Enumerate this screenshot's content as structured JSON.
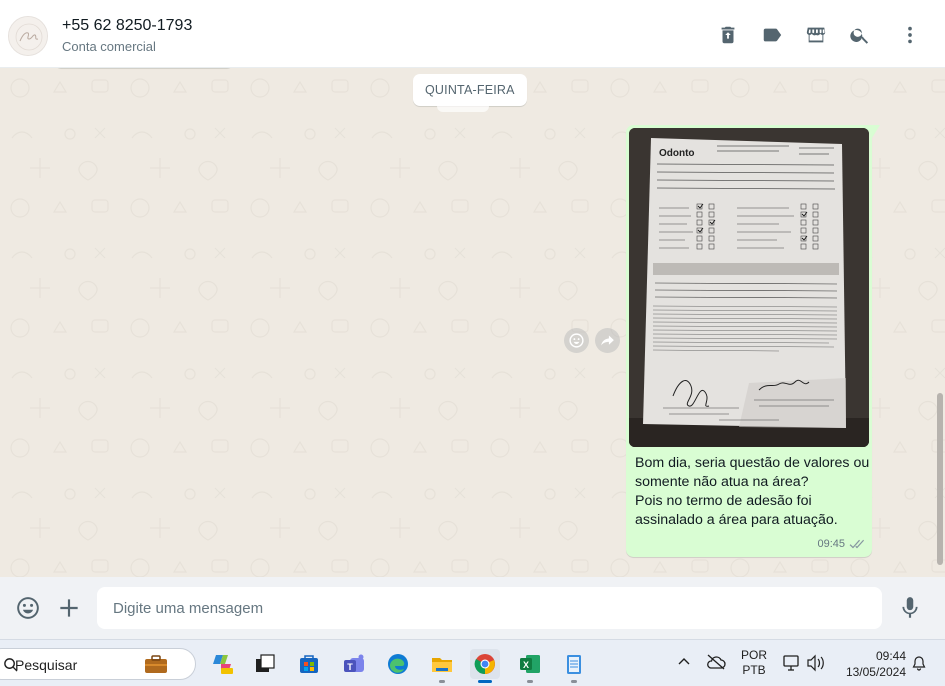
{
  "header": {
    "contact_name": "+55 62 8250-1793",
    "contact_subtitle": "Conta comercial",
    "icons": [
      "delete-icon",
      "label-icon",
      "business-store-icon",
      "search-icon",
      "menu-icon"
    ]
  },
  "chat": {
    "date_chip": "QUINTA-FEIRA",
    "message": {
      "text": "Bom dia, seria questão de valores ou somente não atua na área?\nPois no termo de adesão foi assinalado a área para atuação.",
      "time": "09:45",
      "status": "delivered"
    }
  },
  "composer": {
    "placeholder": "Digite uma mensagem"
  },
  "taskbar": {
    "search_label": "Pesquisar",
    "apps": [
      "copilot",
      "task-view",
      "microsoft-store",
      "teams",
      "edge",
      "file-explorer",
      "chrome",
      "excel",
      "notepad"
    ],
    "language_top": "POR",
    "language_bottom": "PTB",
    "time": "09:44",
    "date": "13/05/2024"
  },
  "colors": {
    "outgoing_bubble": "#d9fdd3",
    "chat_background": "#efeae2",
    "header_background": "#ffffff",
    "icon_gray": "#54656f",
    "read_tick": "#8696a0"
  }
}
